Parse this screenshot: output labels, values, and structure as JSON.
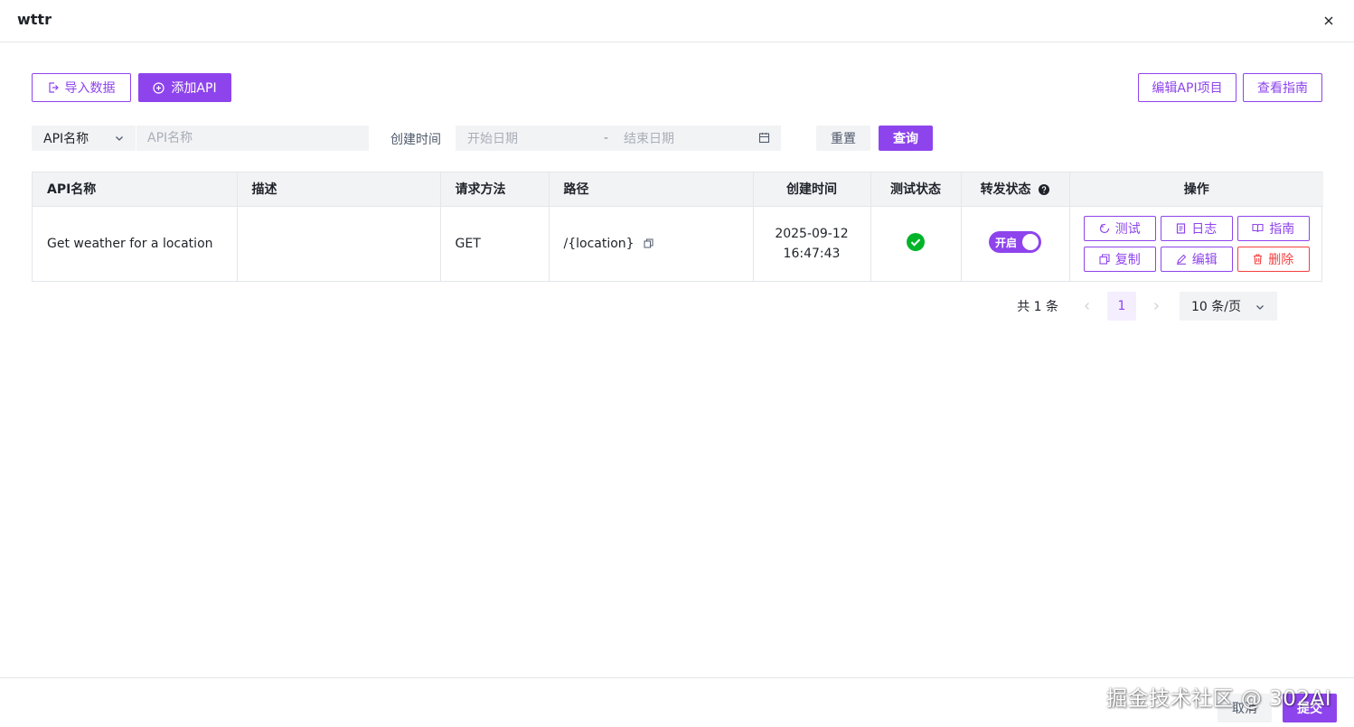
{
  "dialog": {
    "title": "wttr"
  },
  "toolbar": {
    "import_label": "导入数据",
    "add_label": "添加API",
    "edit_project_label": "编辑API项目",
    "guide_label": "查看指南"
  },
  "filters": {
    "field_select": "API名称",
    "name_placeholder": "API名称",
    "date_label": "创建时间",
    "start_placeholder": "开始日期",
    "separator": "-",
    "end_placeholder": "结束日期",
    "reset_label": "重置",
    "query_label": "查询"
  },
  "table": {
    "columns": [
      "API名称",
      "描述",
      "请求方法",
      "路径",
      "创建时间",
      "测试状态",
      "转发状态",
      "操作"
    ],
    "rows": [
      {
        "name": "Get weather for a location",
        "description": "",
        "method": "GET",
        "path": "/{location}",
        "created_date": "2025-09-12",
        "created_time": "16:47:43",
        "test_status": "success",
        "forward_label": "开启",
        "actions": {
          "test": "测试",
          "log": "日志",
          "guide": "指南",
          "copy": "复制",
          "edit": "编辑",
          "delete": "删除"
        }
      }
    ]
  },
  "pagination": {
    "total": "共 1 条",
    "current_page": "1",
    "page_size": "10 条/页"
  },
  "footer": {
    "cancel_label": "取消",
    "submit_label": "提交"
  },
  "watermark": "掘金技术社区 @ 302AI",
  "colors": {
    "primary": "#8e44ec",
    "danger": "#f53f3f",
    "success": "#00b42a",
    "input_bg": "#f2f3f5"
  }
}
